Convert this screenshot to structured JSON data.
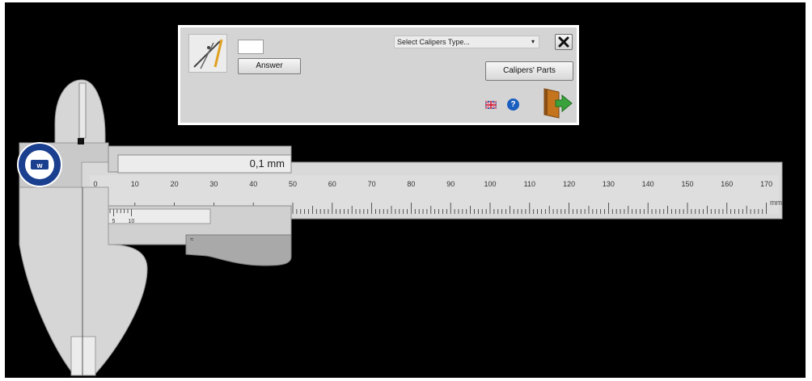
{
  "panel": {
    "answer_value": "",
    "answer_button": "Answer",
    "select_label": "Select Calipers Type...",
    "parts_button": "Calipers' Parts",
    "help_label": "?"
  },
  "caliper": {
    "reading": "0,1 mm",
    "scale_unit": "mm",
    "main_scale_labels": [
      "0",
      "10",
      "20",
      "30",
      "40",
      "50",
      "60",
      "70",
      "80",
      "90",
      "100",
      "110",
      "120",
      "130",
      "140",
      "150",
      "160",
      "170"
    ],
    "vernier_labels": [
      "0",
      "5",
      "10"
    ],
    "resolution_mm": 0.1,
    "main_scale_max_mm": 170
  },
  "colors": {
    "background": "#000000",
    "panel": "#d4d4d4",
    "caliper_body": "#d6d6d6",
    "logo_blue": "#1a3f8f",
    "help_blue": "#1a5fbf",
    "exit_arrow": "#3aa23a"
  },
  "icons": [
    "compass-ruler-icon",
    "close-icon",
    "uk-flag-icon",
    "help-icon",
    "exit-door-icon",
    "university-logo-icon"
  ]
}
